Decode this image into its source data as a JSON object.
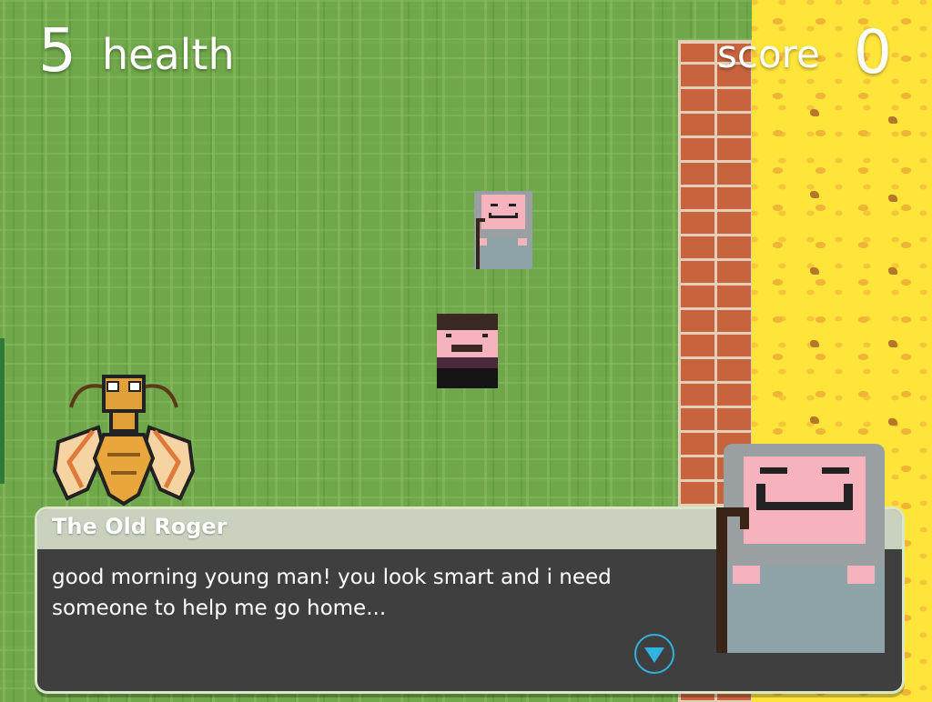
{
  "hud": {
    "health_value": "5",
    "health_label": "health",
    "score_label": "score",
    "score_value": "0"
  },
  "world": {
    "grass_color": "#6fa74a",
    "wall_color": "#c7643e",
    "sand_color": "#ffe53a"
  },
  "characters": [
    {
      "id": "old-roger",
      "icon": "old-man-sprite"
    },
    {
      "id": "player",
      "icon": "mustache-man-sprite"
    },
    {
      "id": "wasp",
      "icon": "wasp-sprite"
    }
  ],
  "dialog": {
    "speaker": "The Old Roger",
    "text_line1": "good morning young man! you look smart and i need",
    "text_line2": "someone to help me go home...",
    "next_icon": "down-triangle-icon",
    "accent_color": "#2fb3e0"
  }
}
